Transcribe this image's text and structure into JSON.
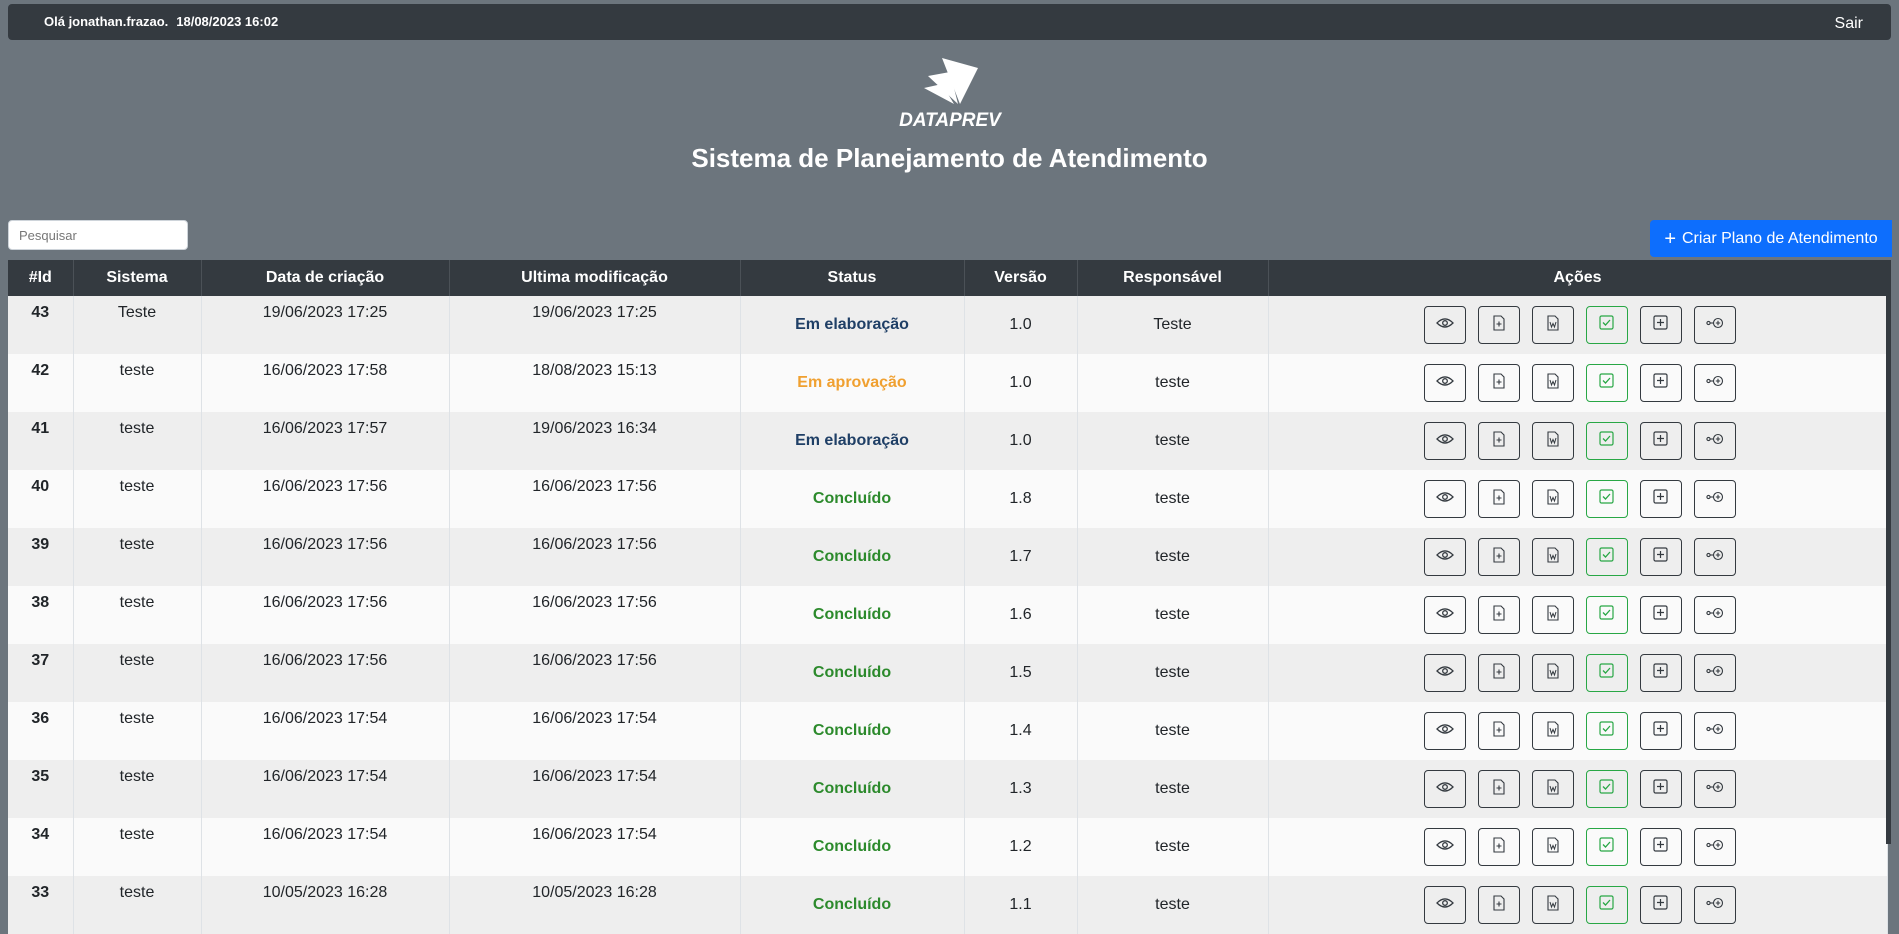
{
  "header": {
    "greeting": "Olá jonathan.frazao.",
    "datetime": "18/08/2023 16:02",
    "logout_label": "Sair"
  },
  "logo": {
    "text": "DATAPREV"
  },
  "title": "Sistema de Planejamento de Atendimento",
  "search": {
    "placeholder": "Pesquisar",
    "value": ""
  },
  "create_button": {
    "label": "Criar Plano de Atendimento",
    "icon": "plus-icon"
  },
  "table": {
    "columns": [
      "#Id",
      "Sistema",
      "Data de criação",
      "Ultima modificação",
      "Status",
      "Versão",
      "Responsável",
      "Ações"
    ],
    "action_icons": [
      "eye-icon",
      "file-plus-icon",
      "word-file-icon",
      "check-square-icon",
      "plus-square-icon",
      "share-node-icon"
    ],
    "rows": [
      {
        "id": "43",
        "sistema": "Teste",
        "criacao": "19/06/2023 17:25",
        "modificacao": "19/06/2023 17:25",
        "status": "Em elaboração",
        "status_kind": "elab",
        "versao": "1.0",
        "responsavel": "Teste"
      },
      {
        "id": "42",
        "sistema": "teste",
        "criacao": "16/06/2023 17:58",
        "modificacao": "18/08/2023 15:13",
        "status": "Em aprovação",
        "status_kind": "aprov",
        "versao": "1.0",
        "responsavel": "teste"
      },
      {
        "id": "41",
        "sistema": "teste",
        "criacao": "16/06/2023 17:57",
        "modificacao": "19/06/2023 16:34",
        "status": "Em elaboração",
        "status_kind": "elab",
        "versao": "1.0",
        "responsavel": "teste"
      },
      {
        "id": "40",
        "sistema": "teste",
        "criacao": "16/06/2023 17:56",
        "modificacao": "16/06/2023 17:56",
        "status": "Concluído",
        "status_kind": "concl",
        "versao": "1.8",
        "responsavel": "teste"
      },
      {
        "id": "39",
        "sistema": "teste",
        "criacao": "16/06/2023 17:56",
        "modificacao": "16/06/2023 17:56",
        "status": "Concluído",
        "status_kind": "concl",
        "versao": "1.7",
        "responsavel": "teste"
      },
      {
        "id": "38",
        "sistema": "teste",
        "criacao": "16/06/2023 17:56",
        "modificacao": "16/06/2023 17:56",
        "status": "Concluído",
        "status_kind": "concl",
        "versao": "1.6",
        "responsavel": "teste"
      },
      {
        "id": "37",
        "sistema": "teste",
        "criacao": "16/06/2023 17:56",
        "modificacao": "16/06/2023 17:56",
        "status": "Concluído",
        "status_kind": "concl",
        "versao": "1.5",
        "responsavel": "teste"
      },
      {
        "id": "36",
        "sistema": "teste",
        "criacao": "16/06/2023 17:54",
        "modificacao": "16/06/2023 17:54",
        "status": "Concluído",
        "status_kind": "concl",
        "versao": "1.4",
        "responsavel": "teste"
      },
      {
        "id": "35",
        "sistema": "teste",
        "criacao": "16/06/2023 17:54",
        "modificacao": "16/06/2023 17:54",
        "status": "Concluído",
        "status_kind": "concl",
        "versao": "1.3",
        "responsavel": "teste"
      },
      {
        "id": "34",
        "sistema": "teste",
        "criacao": "16/06/2023 17:54",
        "modificacao": "16/06/2023 17:54",
        "status": "Concluído",
        "status_kind": "concl",
        "versao": "1.2",
        "responsavel": "teste"
      },
      {
        "id": "33",
        "sistema": "teste",
        "criacao": "10/05/2023 16:28",
        "modificacao": "10/05/2023 16:28",
        "status": "Concluído",
        "status_kind": "concl",
        "versao": "1.1",
        "responsavel": "teste"
      }
    ]
  },
  "colors": {
    "page_bg": "#6c757d",
    "header_bg": "#343a40",
    "primary": "#0d6efd",
    "status_elaboracao": "#1f3f66",
    "status_aprovacao": "#f0a030",
    "status_concluido": "#2c8a2c"
  }
}
